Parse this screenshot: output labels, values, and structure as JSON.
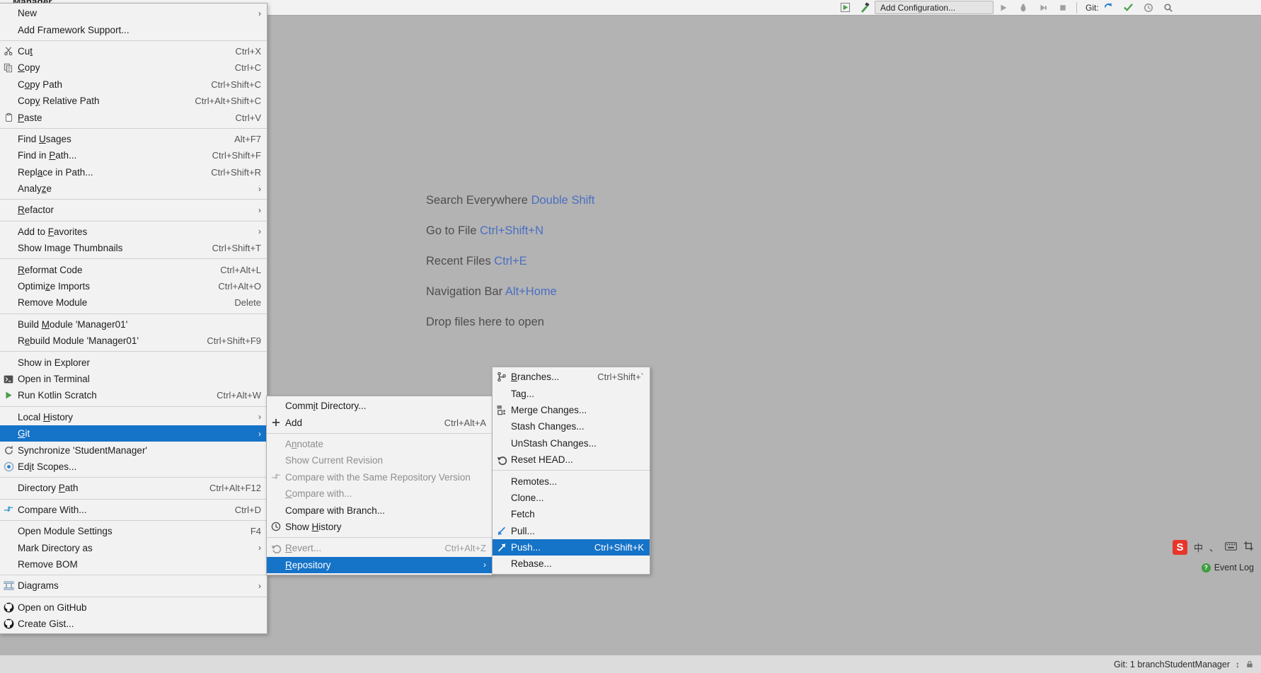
{
  "window": {
    "partial_title": "Manager"
  },
  "toolbar": {
    "run_config_placeholder": "Add Configuration...",
    "git_label": "Git:",
    "icons": [
      "run-icon",
      "build-icon",
      "run-arrow-icon",
      "debug-icon",
      "coverage-icon",
      "stop-icon",
      "vcs-update-icon",
      "commit-icon",
      "history-icon",
      "search-icon"
    ]
  },
  "editor_hints": [
    {
      "label": "Search Everywhere",
      "key": "Double Shift"
    },
    {
      "label": "Go to File",
      "key": "Ctrl+Shift+N"
    },
    {
      "label": "Recent Files",
      "key": "Ctrl+E"
    },
    {
      "label": "Navigation Bar",
      "key": "Alt+Home"
    },
    {
      "label": "Drop files here to open",
      "key": ""
    }
  ],
  "context_menu": {
    "items": [
      {
        "label": "New",
        "shortcut": "",
        "arrow": true,
        "icon": "",
        "state": "normal",
        "mnemonic": ""
      },
      {
        "label": "Add Framework Support...",
        "shortcut": "",
        "arrow": false,
        "icon": "",
        "state": "normal",
        "mnemonic": ""
      },
      {
        "sep": true
      },
      {
        "label": "Cut",
        "shortcut": "Ctrl+X",
        "arrow": false,
        "icon": "scissors-icon",
        "state": "normal",
        "mnemonic": "t"
      },
      {
        "label": "Copy",
        "shortcut": "Ctrl+C",
        "arrow": false,
        "icon": "copy-icon",
        "state": "normal",
        "mnemonic": "C"
      },
      {
        "label": "Copy Path",
        "shortcut": "Ctrl+Shift+C",
        "arrow": false,
        "icon": "",
        "state": "normal",
        "mnemonic": "o"
      },
      {
        "label": "Copy Relative Path",
        "shortcut": "Ctrl+Alt+Shift+C",
        "arrow": false,
        "icon": "",
        "state": "normal",
        "mnemonic": "y"
      },
      {
        "label": "Paste",
        "shortcut": "Ctrl+V",
        "arrow": false,
        "icon": "clipboard-icon",
        "state": "normal",
        "mnemonic": "P"
      },
      {
        "sep": true
      },
      {
        "label": "Find Usages",
        "shortcut": "Alt+F7",
        "arrow": false,
        "icon": "",
        "state": "normal",
        "mnemonic": "U"
      },
      {
        "label": "Find in Path...",
        "shortcut": "Ctrl+Shift+F",
        "arrow": false,
        "icon": "",
        "state": "normal",
        "mnemonic": "P"
      },
      {
        "label": "Replace in Path...",
        "shortcut": "Ctrl+Shift+R",
        "arrow": false,
        "icon": "",
        "state": "normal",
        "mnemonic": "a"
      },
      {
        "label": "Analyze",
        "shortcut": "",
        "arrow": true,
        "icon": "",
        "state": "normal",
        "mnemonic": "z"
      },
      {
        "sep": true
      },
      {
        "label": "Refactor",
        "shortcut": "",
        "arrow": true,
        "icon": "",
        "state": "normal",
        "mnemonic": "R"
      },
      {
        "sep": true
      },
      {
        "label": "Add to Favorites",
        "shortcut": "",
        "arrow": true,
        "icon": "",
        "state": "normal",
        "mnemonic": "F"
      },
      {
        "label": "Show Image Thumbnails",
        "shortcut": "Ctrl+Shift+T",
        "arrow": false,
        "icon": "",
        "state": "normal",
        "mnemonic": ""
      },
      {
        "sep": true
      },
      {
        "label": "Reformat Code",
        "shortcut": "Ctrl+Alt+L",
        "arrow": false,
        "icon": "",
        "state": "normal",
        "mnemonic": "R"
      },
      {
        "label": "Optimize Imports",
        "shortcut": "Ctrl+Alt+O",
        "arrow": false,
        "icon": "",
        "state": "normal",
        "mnemonic": "z"
      },
      {
        "label": "Remove Module",
        "shortcut": "Delete",
        "arrow": false,
        "icon": "",
        "state": "normal",
        "mnemonic": ""
      },
      {
        "sep": true
      },
      {
        "label": "Build Module 'Manager01'",
        "shortcut": "",
        "arrow": false,
        "icon": "",
        "state": "normal",
        "mnemonic": "M"
      },
      {
        "label": "Rebuild Module 'Manager01'",
        "shortcut": "Ctrl+Shift+F9",
        "arrow": false,
        "icon": "",
        "state": "normal",
        "mnemonic": "e"
      },
      {
        "sep": true
      },
      {
        "label": "Show in Explorer",
        "shortcut": "",
        "arrow": false,
        "icon": "",
        "state": "normal",
        "mnemonic": ""
      },
      {
        "label": "Open in Terminal",
        "shortcut": "",
        "arrow": false,
        "icon": "terminal-icon",
        "state": "normal",
        "mnemonic": ""
      },
      {
        "label": "Run Kotlin Scratch",
        "shortcut": "Ctrl+Alt+W",
        "arrow": false,
        "icon": "play-icon",
        "state": "normal",
        "mnemonic": ""
      },
      {
        "sep": true
      },
      {
        "label": "Local History",
        "shortcut": "",
        "arrow": true,
        "icon": "",
        "state": "normal",
        "mnemonic": "H"
      },
      {
        "label": "Git",
        "shortcut": "",
        "arrow": true,
        "icon": "",
        "state": "selected",
        "mnemonic": "G"
      },
      {
        "label": "Synchronize 'StudentManager'",
        "shortcut": "",
        "arrow": false,
        "icon": "refresh-icon",
        "state": "normal",
        "mnemonic": ""
      },
      {
        "label": "Edit Scopes...",
        "shortcut": "",
        "arrow": false,
        "icon": "scope-icon",
        "state": "normal",
        "mnemonic": "i"
      },
      {
        "sep": true
      },
      {
        "label": "Directory Path",
        "shortcut": "Ctrl+Alt+F12",
        "arrow": false,
        "icon": "",
        "state": "normal",
        "mnemonic": "P"
      },
      {
        "sep": true
      },
      {
        "label": "Compare With...",
        "shortcut": "Ctrl+D",
        "arrow": false,
        "icon": "compare-icon",
        "state": "normal",
        "mnemonic": ""
      },
      {
        "sep": true
      },
      {
        "label": "Open Module Settings",
        "shortcut": "F4",
        "arrow": false,
        "icon": "",
        "state": "normal",
        "mnemonic": ""
      },
      {
        "label": "Mark Directory as",
        "shortcut": "",
        "arrow": true,
        "icon": "",
        "state": "normal",
        "mnemonic": ""
      },
      {
        "label": "Remove BOM",
        "shortcut": "",
        "arrow": false,
        "icon": "",
        "state": "normal",
        "mnemonic": ""
      },
      {
        "sep": true
      },
      {
        "label": "Diagrams",
        "shortcut": "",
        "arrow": true,
        "icon": "diagram-icon",
        "state": "normal",
        "mnemonic": ""
      },
      {
        "sep": true
      },
      {
        "label": "Open on GitHub",
        "shortcut": "",
        "arrow": false,
        "icon": "github-icon",
        "state": "normal",
        "mnemonic": ""
      },
      {
        "label": "Create Gist...",
        "shortcut": "",
        "arrow": false,
        "icon": "github-icon",
        "state": "normal",
        "mnemonic": ""
      }
    ]
  },
  "git_menu": {
    "items": [
      {
        "label": "Commit Directory...",
        "shortcut": "",
        "arrow": false,
        "icon": "",
        "state": "normal",
        "mnemonic": "i"
      },
      {
        "label": "Add",
        "shortcut": "Ctrl+Alt+A",
        "arrow": false,
        "icon": "plus-icon",
        "state": "normal",
        "mnemonic": ""
      },
      {
        "sep": true
      },
      {
        "label": "Annotate",
        "shortcut": "",
        "arrow": false,
        "icon": "",
        "state": "disabled",
        "mnemonic": "n"
      },
      {
        "label": "Show Current Revision",
        "shortcut": "",
        "arrow": false,
        "icon": "",
        "state": "disabled",
        "mnemonic": ""
      },
      {
        "label": "Compare with the Same Repository Version",
        "shortcut": "",
        "arrow": false,
        "icon": "compare-icon",
        "state": "disabled",
        "mnemonic": ""
      },
      {
        "label": "Compare with...",
        "shortcut": "",
        "arrow": false,
        "icon": "",
        "state": "disabled",
        "mnemonic": "C"
      },
      {
        "label": "Compare with Branch...",
        "shortcut": "",
        "arrow": false,
        "icon": "",
        "state": "normal",
        "mnemonic": ""
      },
      {
        "label": "Show History",
        "shortcut": "",
        "arrow": false,
        "icon": "history-icon",
        "state": "normal",
        "mnemonic": "H"
      },
      {
        "sep": true
      },
      {
        "label": "Revert...",
        "shortcut": "Ctrl+Alt+Z",
        "arrow": false,
        "icon": "revert-icon",
        "state": "disabled",
        "mnemonic": "R"
      },
      {
        "label": "Repository",
        "shortcut": "",
        "arrow": true,
        "icon": "",
        "state": "selected",
        "mnemonic": "R"
      }
    ]
  },
  "repository_menu": {
    "items": [
      {
        "label": "Branches...",
        "shortcut": "Ctrl+Shift+`",
        "arrow": false,
        "icon": "branch-icon",
        "state": "normal",
        "mnemonic": "B"
      },
      {
        "label": "Tag...",
        "shortcut": "",
        "arrow": false,
        "icon": "",
        "state": "normal",
        "mnemonic": ""
      },
      {
        "label": "Merge Changes...",
        "shortcut": "",
        "arrow": false,
        "icon": "merge-icon",
        "state": "normal",
        "mnemonic": ""
      },
      {
        "label": "Stash Changes...",
        "shortcut": "",
        "arrow": false,
        "icon": "",
        "state": "normal",
        "mnemonic": ""
      },
      {
        "label": "UnStash Changes...",
        "shortcut": "",
        "arrow": false,
        "icon": "",
        "state": "normal",
        "mnemonic": ""
      },
      {
        "label": "Reset HEAD...",
        "shortcut": "",
        "arrow": false,
        "icon": "revert-icon",
        "state": "normal",
        "mnemonic": ""
      },
      {
        "sep": true
      },
      {
        "label": "Remotes...",
        "shortcut": "",
        "arrow": false,
        "icon": "",
        "state": "normal",
        "mnemonic": ""
      },
      {
        "label": "Clone...",
        "shortcut": "",
        "arrow": false,
        "icon": "",
        "state": "normal",
        "mnemonic": ""
      },
      {
        "label": "Fetch",
        "shortcut": "",
        "arrow": false,
        "icon": "",
        "state": "normal",
        "mnemonic": ""
      },
      {
        "label": "Pull...",
        "shortcut": "",
        "arrow": false,
        "icon": "pull-icon",
        "state": "normal",
        "mnemonic": ""
      },
      {
        "label": "Push...",
        "shortcut": "Ctrl+Shift+K",
        "arrow": false,
        "icon": "push-icon",
        "state": "selected",
        "mnemonic": ""
      },
      {
        "label": "Rebase...",
        "shortcut": "",
        "arrow": false,
        "icon": "",
        "state": "normal",
        "mnemonic": ""
      }
    ]
  },
  "status_bar": {
    "git_branch": "Git: 1 branchStudentManager",
    "event_log": "Event Log",
    "event_log_badge": "?"
  },
  "ime": {
    "logo": "S",
    "mode": "中",
    "items": [
      "comma-icon",
      "keyboard-icon",
      "crop-icon"
    ]
  },
  "colors": {
    "selection": "#1573c8",
    "menu_bg": "#f2f2f2",
    "editor_bg": "#b3b3b3",
    "hint_key": "#4a6fc2",
    "disabled_text": "#8e8e8e"
  }
}
